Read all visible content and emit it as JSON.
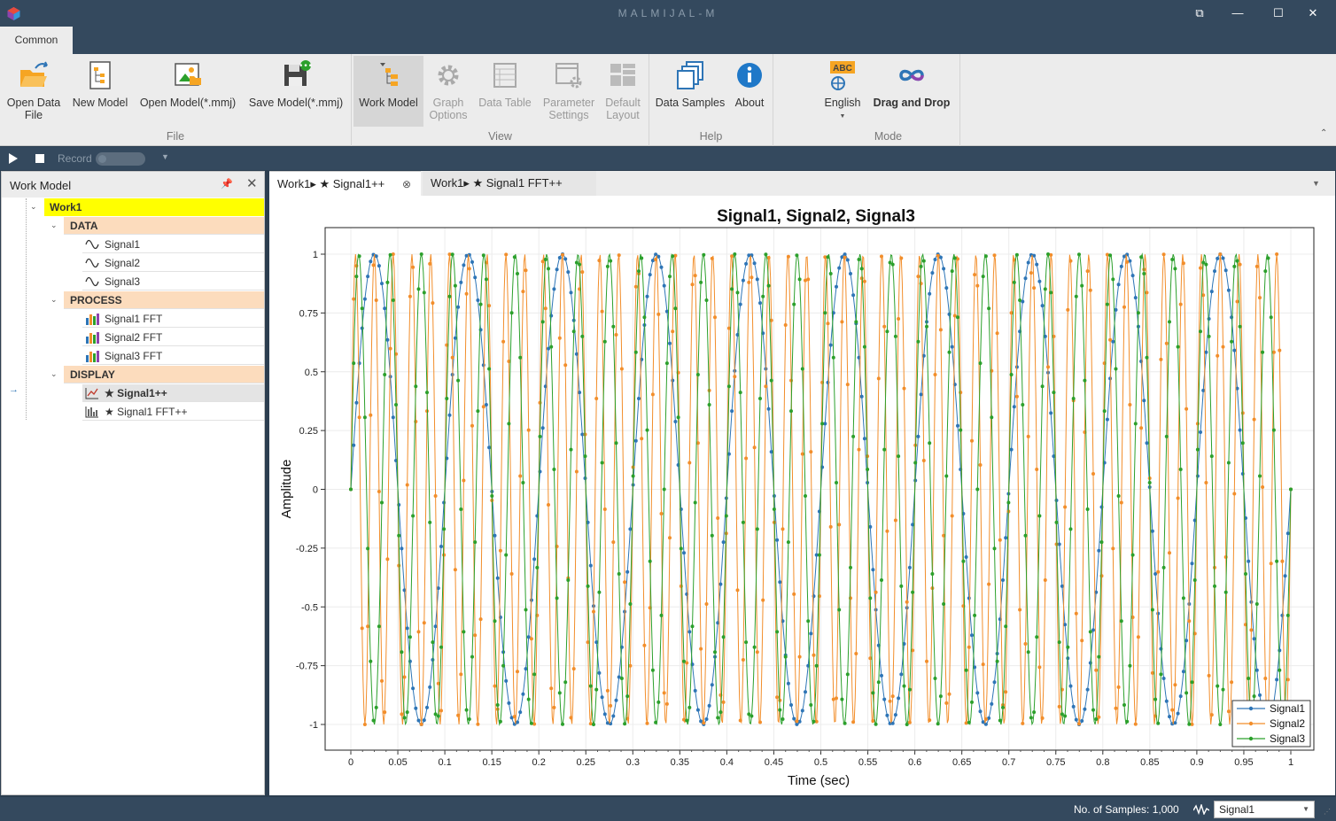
{
  "window": {
    "title": "MALMIJAL-M",
    "buttons": [
      "restore",
      "minimize",
      "maximize",
      "close"
    ]
  },
  "ribbon": {
    "tabs": [
      {
        "label": "Common"
      }
    ],
    "groups": [
      {
        "label": "File",
        "buttons": [
          {
            "label": "Open Data\nFile",
            "icon": "open-folder-icon"
          },
          {
            "label": "New Model",
            "icon": "new-model-icon"
          },
          {
            "label": "Open Model(*.mmj)",
            "icon": "open-model-icon"
          },
          {
            "label": "Save Model(*.mmj)",
            "icon": "save-model-icon"
          }
        ]
      },
      {
        "label": "View",
        "buttons": [
          {
            "label": "Work Model",
            "icon": "work-model-icon",
            "active": true
          },
          {
            "label": "Graph\nOptions",
            "icon": "gear-icon",
            "disabled": true
          },
          {
            "label": "Data Table",
            "icon": "table-icon",
            "disabled": true
          },
          {
            "label": "Parameter\nSettings",
            "icon": "parameter-settings-icon",
            "disabled": true
          },
          {
            "label": "Default\nLayout",
            "icon": "layout-icon",
            "disabled": true
          }
        ]
      },
      {
        "label": "Help",
        "buttons": [
          {
            "label": "Data Samples",
            "icon": "data-samples-icon"
          },
          {
            "label": "About",
            "icon": "info-icon"
          }
        ]
      },
      {
        "label": "Mode",
        "buttons": [
          {
            "label": "English",
            "icon": "language-icon",
            "icon_text": "ABC"
          },
          {
            "label": "Drag and Drop",
            "icon": "infinity-icon"
          }
        ]
      }
    ]
  },
  "toolbar": {
    "record_label": "Record"
  },
  "work_model": {
    "title": "Work Model",
    "root": "Work1",
    "sections": [
      {
        "label": "DATA",
        "items": [
          "Signal1",
          "Signal2",
          "Signal3"
        ]
      },
      {
        "label": "PROCESS",
        "items": [
          "Signal1 FFT",
          "Signal2 FFT",
          "Signal3 FFT"
        ]
      },
      {
        "label": "DISPLAY",
        "items": [
          "★ Signal1++",
          "★ Signal1 FFT++"
        ]
      }
    ]
  },
  "doc_tabs": [
    {
      "label": "Work1▸ ★ Signal1++"
    },
    {
      "label": "Work1▸ ★ Signal1 FFT++"
    }
  ],
  "status": {
    "samples": "No. of Samples: 1,000",
    "selected_signal": "Signal1"
  },
  "colors": {
    "signal1": "#2e75b6",
    "signal2": "#f28e2b",
    "signal3": "#2ca02c",
    "root_highlight": "#ffff00",
    "section_bg": "#fcdcbd"
  },
  "chart_data": {
    "type": "line",
    "title": "Signal1, Signal2, Signal3",
    "xlabel": "Time (sec)",
    "ylabel": "Amplitude",
    "xlim": [
      0,
      1
    ],
    "ylim": [
      -1,
      1
    ],
    "xticks": [
      "0",
      "0.05",
      "0.1",
      "0.15",
      "0.2",
      "0.25",
      "0.3",
      "0.35",
      "0.4",
      "0.45",
      "0.5",
      "0.55",
      "0.6",
      "0.65",
      "0.7",
      "0.75",
      "0.8",
      "0.85",
      "0.9",
      "0.95",
      "1"
    ],
    "yticks": [
      "1",
      "0.75",
      "0.5",
      "0.25",
      "0",
      "-0.25",
      "-0.5",
      "-0.75",
      "-1"
    ],
    "grid": true,
    "legend": "bottom-right",
    "samples": 1000,
    "series": [
      {
        "name": "Signal1",
        "color": "#2e75b6",
        "function": "sin",
        "frequency_hz": 10
      },
      {
        "name": "Signal2",
        "color": "#f28e2b",
        "function": "sin",
        "frequency_hz": 50
      },
      {
        "name": "Signal3",
        "color": "#2ca02c",
        "function": "sin",
        "frequency_hz": 30
      }
    ]
  }
}
